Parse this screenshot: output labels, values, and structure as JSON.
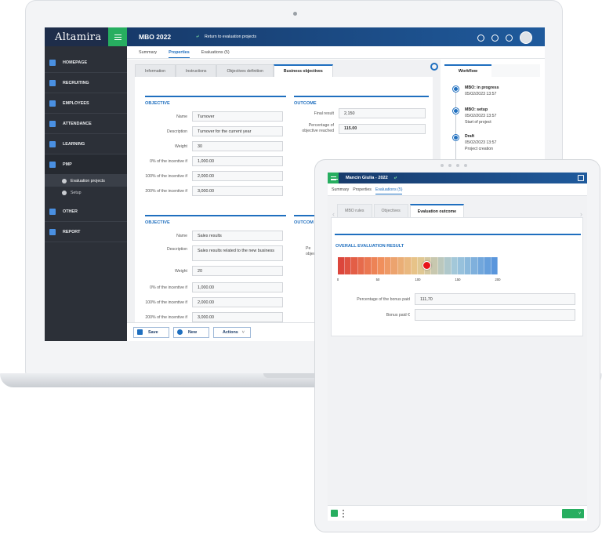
{
  "app": {
    "brand": "Altamira",
    "title": "MBO 2022",
    "back_label": "Return to evaluation projects"
  },
  "sidebar": {
    "items": [
      {
        "label": "HOMEPAGE"
      },
      {
        "label": "RECRUITING"
      },
      {
        "label": "EMPLOYEES"
      },
      {
        "label": "ATTENDANCE"
      },
      {
        "label": "LEARNING"
      },
      {
        "label": "PMP"
      },
      {
        "label": "OTHER"
      },
      {
        "label": "REPORT"
      }
    ],
    "pmp_sub": [
      {
        "label": "Evaluation projects"
      },
      {
        "label": "Setup"
      }
    ]
  },
  "tabs": [
    "Summary",
    "Properties",
    "Evaluations (5)"
  ],
  "subtabs": [
    "Information",
    "Instructions",
    "Objectives definition",
    "Business objectives"
  ],
  "sections": {
    "objective": "OBJECTIVE",
    "outcome": "OUTCOME",
    "outcome_cut": "OUTCOM"
  },
  "objective1": {
    "name_label": "Name",
    "name": "Turnover",
    "desc_label": "Description",
    "desc": "Turnover for the current year",
    "weight_label": "Weight",
    "weight": "30",
    "i0_label": "0% of the incentive if",
    "i0": "1,000.00",
    "i100_label": "100% of the incentive if",
    "i100": "2,000.00",
    "i200_label": "200% of the incentive if",
    "i200": "3,000.00"
  },
  "outcome1": {
    "final_label": "Final result",
    "final": "2,150",
    "pct_label_1": "Percentage of",
    "pct_label_2": "objective reached",
    "pct": "115.00"
  },
  "objective2": {
    "name_label": "Name",
    "name": "Sales results",
    "desc_label": "Description",
    "desc": "Sales results related to the new business",
    "weight_label": "Weight",
    "weight": "20",
    "i0_label": "0% of the incentive if",
    "i0": "1,000.00",
    "i100_label": "100% of the incentive if",
    "i100": "2,000.00",
    "i200_label": "200% of the incentive if",
    "i200": "3,000.00",
    "outcome_label_cut_1": "Pe",
    "outcome_label_cut_2": "objecti"
  },
  "actions": {
    "save": "Save",
    "new": "New",
    "actions": "Actions"
  },
  "workflow": {
    "tab": "Workflow",
    "steps": [
      {
        "status": "MBO: in progress",
        "date": "05/02/2023 13:57",
        "note": ""
      },
      {
        "status": "MBO: setup",
        "date": "05/02/2023 13:57",
        "note": "Start of project"
      },
      {
        "status": "Draft",
        "date": "05/02/2023 13:57",
        "note": "Project creation"
      }
    ]
  },
  "tablet": {
    "title": "Mancin Giulia - 2022",
    "tabs": [
      "Summary",
      "Properties",
      "Evaluations (5)"
    ],
    "subtabs": [
      "MBO rules",
      "Objectives",
      "Evaluation outcome"
    ],
    "section": "OVERALL EVALUATION RESULT",
    "scale": {
      "min": 0,
      "max": 200,
      "value": 111.7,
      "ticks": [
        "0",
        "50",
        "100",
        "150",
        "200"
      ]
    },
    "bonus_pct_label": "Percentage of the bonus paid",
    "bonus_pct": "111,70",
    "bonus_paid_label": "Bonus paid €",
    "bonus_paid": ""
  },
  "colors": {
    "accent": "#1f6fbf",
    "green": "#27ae60",
    "sidebar": "#2c3038",
    "marker": "#e8141a"
  }
}
